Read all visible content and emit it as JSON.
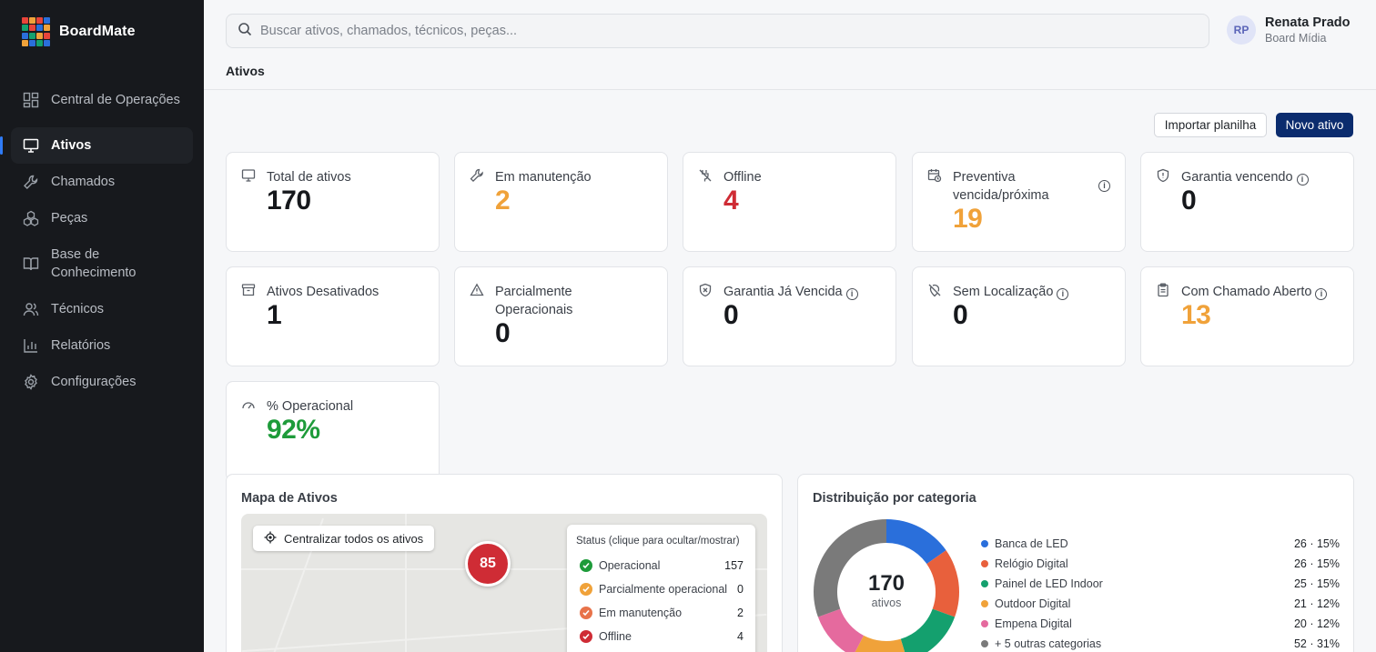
{
  "app": {
    "name": "BoardMate"
  },
  "sidebar": {
    "items": [
      {
        "label": "Central de Operações",
        "icon": "dashboard-grid-icon"
      },
      {
        "label": "Ativos",
        "icon": "monitor-icon",
        "active": true
      },
      {
        "label": "Chamados",
        "icon": "wrench-icon"
      },
      {
        "label": "Peças",
        "icon": "boxes-icon"
      },
      {
        "label": "Base de Conhecimento",
        "icon": "book-icon"
      },
      {
        "label": "Técnicos",
        "icon": "users-icon"
      },
      {
        "label": "Relatórios",
        "icon": "bar-chart-icon"
      },
      {
        "label": "Configurações",
        "icon": "gear-icon"
      }
    ]
  },
  "topbar": {
    "search_placeholder": "Buscar ativos, chamados, técnicos, peças...",
    "user": {
      "initials": "RP",
      "name": "Renata Prado",
      "org": "Board Mídia"
    },
    "breadcrumb": "Ativos"
  },
  "actions": {
    "import_label": "Importar planilha",
    "new_label": "Novo ativo"
  },
  "kpis": [
    {
      "label": "Total de ativos",
      "value": "170",
      "icon": "monitor-icon",
      "color": "#16181c"
    },
    {
      "label": "Em manutenção",
      "value": "2",
      "icon": "wrench-icon",
      "color": "#f0a23a"
    },
    {
      "label": "Offline",
      "value": "4",
      "icon": "plug-off-icon",
      "color": "#cf2c35"
    },
    {
      "label": "Preventiva vencida/próxima",
      "value": "19",
      "icon": "calendar-clock-icon",
      "color": "#f0a23a",
      "info": true
    },
    {
      "label": "Garantia vencendo",
      "value": "0",
      "icon": "shield-icon",
      "color": "#16181c",
      "info": true
    },
    {
      "label": "Ativos Desativados",
      "value": "1",
      "icon": "archive-icon",
      "color": "#16181c"
    },
    {
      "label": "Parcialmente Operacionais",
      "value": "0",
      "icon": "warning-icon",
      "color": "#16181c"
    },
    {
      "label": "Garantia Já Vencida",
      "value": "0",
      "icon": "shield-x-icon",
      "color": "#16181c",
      "info": true
    },
    {
      "label": "Sem Localização",
      "value": "0",
      "icon": "map-pin-off-icon",
      "color": "#16181c",
      "info": true
    },
    {
      "label": "Com Chamado Aberto",
      "value": "13",
      "icon": "clipboard-icon",
      "color": "#f0a23a",
      "info": true
    },
    {
      "label": "% Operacional",
      "value": "92%",
      "icon": "gauge-icon",
      "color": "#1e9b3a"
    }
  ],
  "map_panel": {
    "title": "Mapa de Ativos",
    "center_button": "Centralizar todos os ativos",
    "cluster_count": "85",
    "status_title": "Status (clique para ocultar/mostrar)",
    "statuses": [
      {
        "label": "Operacional",
        "count": "157",
        "color": "#1e9b3a"
      },
      {
        "label": "Parcialmente operacional",
        "count": "0",
        "color": "#f0a23a"
      },
      {
        "label": "Em manutenção",
        "count": "2",
        "color": "#e8734a"
      },
      {
        "label": "Offline",
        "count": "4",
        "color": "#cf2c35"
      }
    ]
  },
  "category_panel": {
    "title": "Distribuição por categoria",
    "center_total": "170",
    "center_label": "ativos"
  },
  "chart_data": {
    "type": "pie",
    "title": "Distribuição por categoria",
    "categories": [
      "Banca de LED",
      "Relógio Digital",
      "Painel de LED Indoor",
      "Outdoor Digital",
      "Empena Digital",
      "+ 5 outras categorias"
    ],
    "values": [
      26,
      26,
      25,
      21,
      20,
      52
    ],
    "labels": [
      "26 · 15%",
      "26 · 15%",
      "25 · 15%",
      "21 · 12%",
      "20 · 12%",
      "52 · 31%"
    ],
    "colors": [
      "#2a6fdb",
      "#e8603c",
      "#14a06e",
      "#f0a23a",
      "#e56a9e",
      "#7a7a7a"
    ],
    "total": 170
  }
}
